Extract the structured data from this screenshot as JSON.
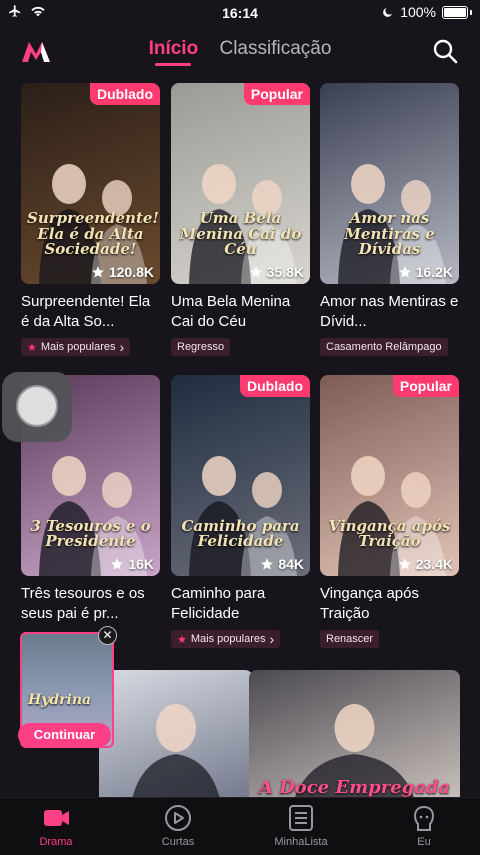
{
  "status": {
    "time": "16:14",
    "battery": "100%"
  },
  "nav": {
    "tab_active": "Início",
    "tab_inactive": "Classificação"
  },
  "cards": [
    {
      "badge": "Dublado",
      "views": "120.8K",
      "title": "Surpreendente! Ela é da Alta So...",
      "tag": "Mais populares",
      "tag_arrow": true,
      "poster_text": "Surpreendente! Ela é da Alta Sociedade!",
      "colors": [
        "#2b1f18",
        "#6a4a2e"
      ]
    },
    {
      "badge": "Popular",
      "views": "35.8K",
      "title": "Uma Bela Menina Cai do Céu",
      "tag": "Regresso",
      "tag_arrow": false,
      "poster_text": "Uma Bela Menina Cai do Céu",
      "colors": [
        "#9b9a95",
        "#d8d5cf"
      ]
    },
    {
      "badge": "",
      "views": "16.2K",
      "title": "Amor nas Mentiras e Dívid...",
      "tag": "Casamento Relâmpago",
      "tag_arrow": false,
      "poster_text": "Amor nas Mentiras e Dívidas",
      "colors": [
        "#3a4052",
        "#b7b9c4"
      ]
    },
    {
      "badge": "",
      "views": "16K",
      "title": "Três tesouros e os seus pai é pr...",
      "tag": "",
      "tag_arrow": false,
      "poster_text": "3 Tesouros e o Presidente",
      "colors": [
        "#5b3a5a",
        "#c9a6c9"
      ]
    },
    {
      "badge": "Dublado",
      "views": "84K",
      "title": "Caminho para Felicidade",
      "tag": "Mais populares",
      "tag_arrow": true,
      "poster_text": "Caminho para Felicidade",
      "colors": [
        "#1f2d3f",
        "#6c6e7a"
      ]
    },
    {
      "badge": "Popular",
      "views": "23.4K",
      "title": "Vingança após Traição",
      "tag": "Renascer",
      "tag_arrow": false,
      "poster_text": "Vingança após Traição",
      "colors": [
        "#7d5c55",
        "#e1c3b6"
      ]
    }
  ],
  "bottom_cards": [
    {
      "poster_text": "",
      "colors": [
        "#d8dbe3",
        "#6d7487"
      ]
    },
    {
      "poster_text": "A Doce Empregada",
      "colors": [
        "#4c4a52",
        "#cfc6c0"
      ]
    }
  ],
  "mini_player": {
    "title": "Hydrina",
    "button": "Continuar"
  },
  "bottom_nav": [
    {
      "label": "Drama",
      "icon": "drama-icon",
      "active": true
    },
    {
      "label": "Curtas",
      "icon": "play-circle-icon",
      "active": false
    },
    {
      "label": "MinhaLista",
      "icon": "list-icon",
      "active": false
    },
    {
      "label": "Eu",
      "icon": "profile-icon",
      "active": false
    }
  ],
  "accent": "#ff3f86"
}
